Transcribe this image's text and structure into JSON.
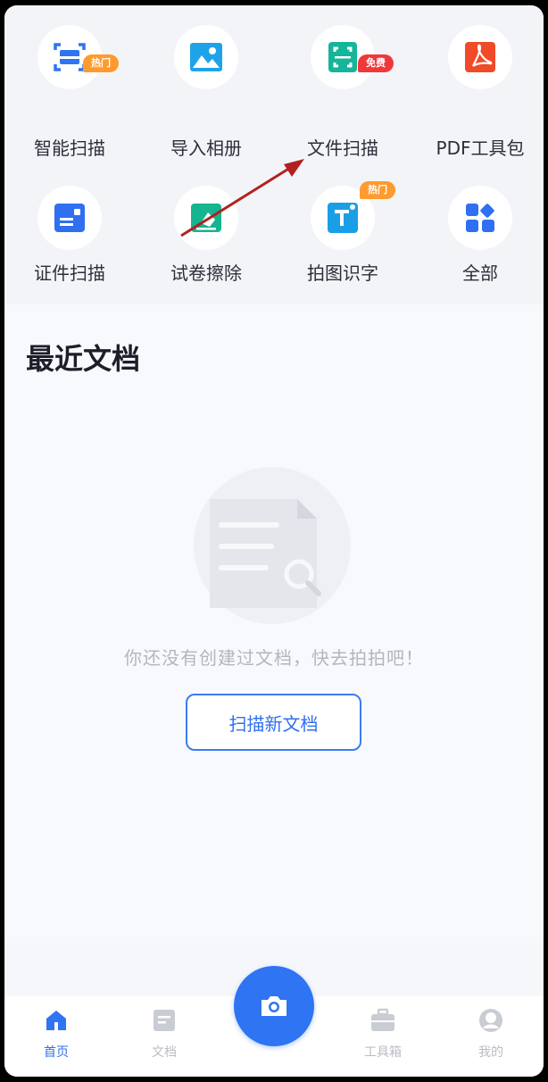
{
  "tools": {
    "row1": [
      {
        "label": "智能扫描",
        "icon": "smart-scan-icon",
        "badge": "热门",
        "badge_type": "hot"
      },
      {
        "label": "导入相册",
        "icon": "import-album-icon"
      },
      {
        "label": "文件扫描",
        "icon": "file-scan-icon",
        "badge": "免费",
        "badge_type": "red"
      },
      {
        "label": "PDF工具包",
        "icon": "pdf-icon"
      }
    ],
    "row2": [
      {
        "label": "证件扫描",
        "icon": "id-card-icon"
      },
      {
        "label": "试卷擦除",
        "icon": "eraser-icon"
      },
      {
        "label": "拍图识字",
        "icon": "text-recognition-icon",
        "badge": "热门",
        "badge_type": "hot"
      },
      {
        "label": "全部",
        "icon": "all-apps-icon"
      }
    ]
  },
  "recent": {
    "title": "最近文档",
    "empty_text": "你还没有创建过文档，快去拍拍吧！",
    "scan_button": "扫描新文档"
  },
  "tabbar": {
    "tabs": [
      {
        "label": "首页",
        "icon": "home-icon",
        "active": true
      },
      {
        "label": "文档",
        "icon": "document-icon",
        "active": false
      },
      {
        "label": "工具箱",
        "icon": "toolbox-icon",
        "active": false
      },
      {
        "label": "我的",
        "icon": "profile-icon",
        "active": false
      }
    ],
    "camera": "camera-icon"
  },
  "colors": {
    "accent": "#2f74f2",
    "hot_badge": "#ff9a2e",
    "free_badge": "#f0383a",
    "arrow": "#b32020"
  }
}
